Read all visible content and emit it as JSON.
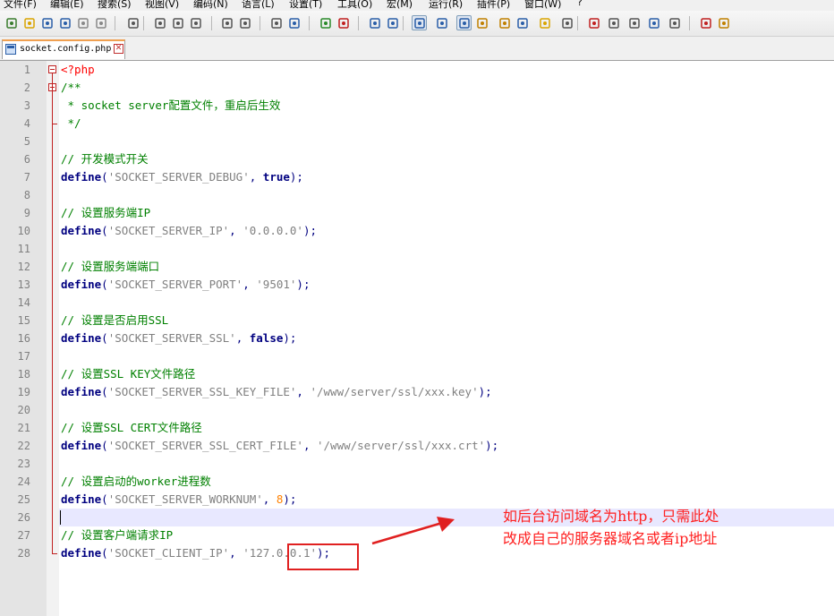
{
  "menu": [
    "文件(F)",
    "编辑(E)",
    "搜索(S)",
    "视图(V)",
    "编码(N)",
    "语言(L)",
    "设置(T)",
    "工具(O)",
    "宏(M)",
    "运行(R)",
    "插件(P)",
    "窗口(W)",
    "?"
  ],
  "toolbar": {
    "buttons": [
      "new-file-icon",
      "open-file-icon",
      "save-icon",
      "save-all-icon",
      "close-icon",
      "close-all-icon",
      "print-icon",
      "cut-icon",
      "copy-icon",
      "paste-icon",
      "undo-icon",
      "redo-icon",
      "find-icon",
      "replace-icon",
      "zoom-in-icon",
      "zoom-out-icon",
      "sync-vertical-icon",
      "sync-horizontal-icon",
      "word-wrap-icon",
      "show-all-chars-icon",
      "indent-guide-icon",
      "language-udl-icon",
      "doc-map-icon",
      "function-list-icon",
      "folder-workspace-icon",
      "monitor-icon",
      "record-macro-icon",
      "stop-record-icon",
      "play-macro-icon",
      "run-macro-multiple-icon",
      "save-macro-icon",
      "spellcheck-icon",
      "plugin-icon"
    ]
  },
  "tab": {
    "label": "socket.config.php"
  },
  "editor": {
    "current_line": 26,
    "lines": [
      [
        [
          "php",
          "<?php"
        ]
      ],
      [
        [
          "comment",
          "/**"
        ]
      ],
      [
        [
          "comment",
          " * socket server配置文件，重启后生效"
        ]
      ],
      [
        [
          "comment",
          " */"
        ]
      ],
      [],
      [
        [
          "comment",
          "// 开发模式开关"
        ]
      ],
      [
        [
          "kw",
          "define"
        ],
        [
          "op",
          "("
        ],
        [
          "str",
          "'SOCKET_SERVER_DEBUG'"
        ],
        [
          "op",
          ", "
        ],
        [
          "kw",
          "true"
        ],
        [
          "op",
          ");"
        ]
      ],
      [],
      [
        [
          "comment",
          "// 设置服务端IP"
        ]
      ],
      [
        [
          "kw",
          "define"
        ],
        [
          "op",
          "("
        ],
        [
          "str",
          "'SOCKET_SERVER_IP'"
        ],
        [
          "op",
          ", "
        ],
        [
          "str",
          "'0.0.0.0'"
        ],
        [
          "op",
          ");"
        ]
      ],
      [],
      [
        [
          "comment",
          "// 设置服务端端口"
        ]
      ],
      [
        [
          "kw",
          "define"
        ],
        [
          "op",
          "("
        ],
        [
          "str",
          "'SOCKET_SERVER_PORT'"
        ],
        [
          "op",
          ", "
        ],
        [
          "str",
          "'9501'"
        ],
        [
          "op",
          ");"
        ]
      ],
      [],
      [
        [
          "comment",
          "// 设置是否启用SSL"
        ]
      ],
      [
        [
          "kw",
          "define"
        ],
        [
          "op",
          "("
        ],
        [
          "str",
          "'SOCKET_SERVER_SSL'"
        ],
        [
          "op",
          ", "
        ],
        [
          "kw",
          "false"
        ],
        [
          "op",
          ");"
        ]
      ],
      [],
      [
        [
          "comment",
          "// 设置SSL KEY文件路径"
        ]
      ],
      [
        [
          "kw",
          "define"
        ],
        [
          "op",
          "("
        ],
        [
          "str",
          "'SOCKET_SERVER_SSL_KEY_FILE'"
        ],
        [
          "op",
          ", "
        ],
        [
          "str",
          "'/www/server/ssl/xxx.key'"
        ],
        [
          "op",
          ");"
        ]
      ],
      [],
      [
        [
          "comment",
          "// 设置SSL CERT文件路径"
        ]
      ],
      [
        [
          "kw",
          "define"
        ],
        [
          "op",
          "("
        ],
        [
          "str",
          "'SOCKET_SERVER_SSL_CERT_FILE'"
        ],
        [
          "op",
          ", "
        ],
        [
          "str",
          "'/www/server/ssl/xxx.crt'"
        ],
        [
          "op",
          ");"
        ]
      ],
      [],
      [
        [
          "comment",
          "// 设置启动的worker进程数"
        ]
      ],
      [
        [
          "kw",
          "define"
        ],
        [
          "op",
          "("
        ],
        [
          "str",
          "'SOCKET_SERVER_WORKNUM'"
        ],
        [
          "op",
          ", "
        ],
        [
          "num",
          "8"
        ],
        [
          "op",
          ");"
        ]
      ],
      [],
      [
        [
          "comment",
          "// 设置客户端请求IP"
        ]
      ],
      [
        [
          "kw",
          "define"
        ],
        [
          "op",
          "("
        ],
        [
          "str",
          "'SOCKET_CLIENT_IP'"
        ],
        [
          "op",
          ", "
        ],
        [
          "str",
          "'127.0.0.1'"
        ],
        [
          "op",
          ");"
        ]
      ]
    ]
  },
  "annotation": {
    "lines": [
      "如后台访问域名为http，只需此处",
      "改成自己的服务器域名或者ip地址"
    ],
    "color": "#ff2020"
  }
}
